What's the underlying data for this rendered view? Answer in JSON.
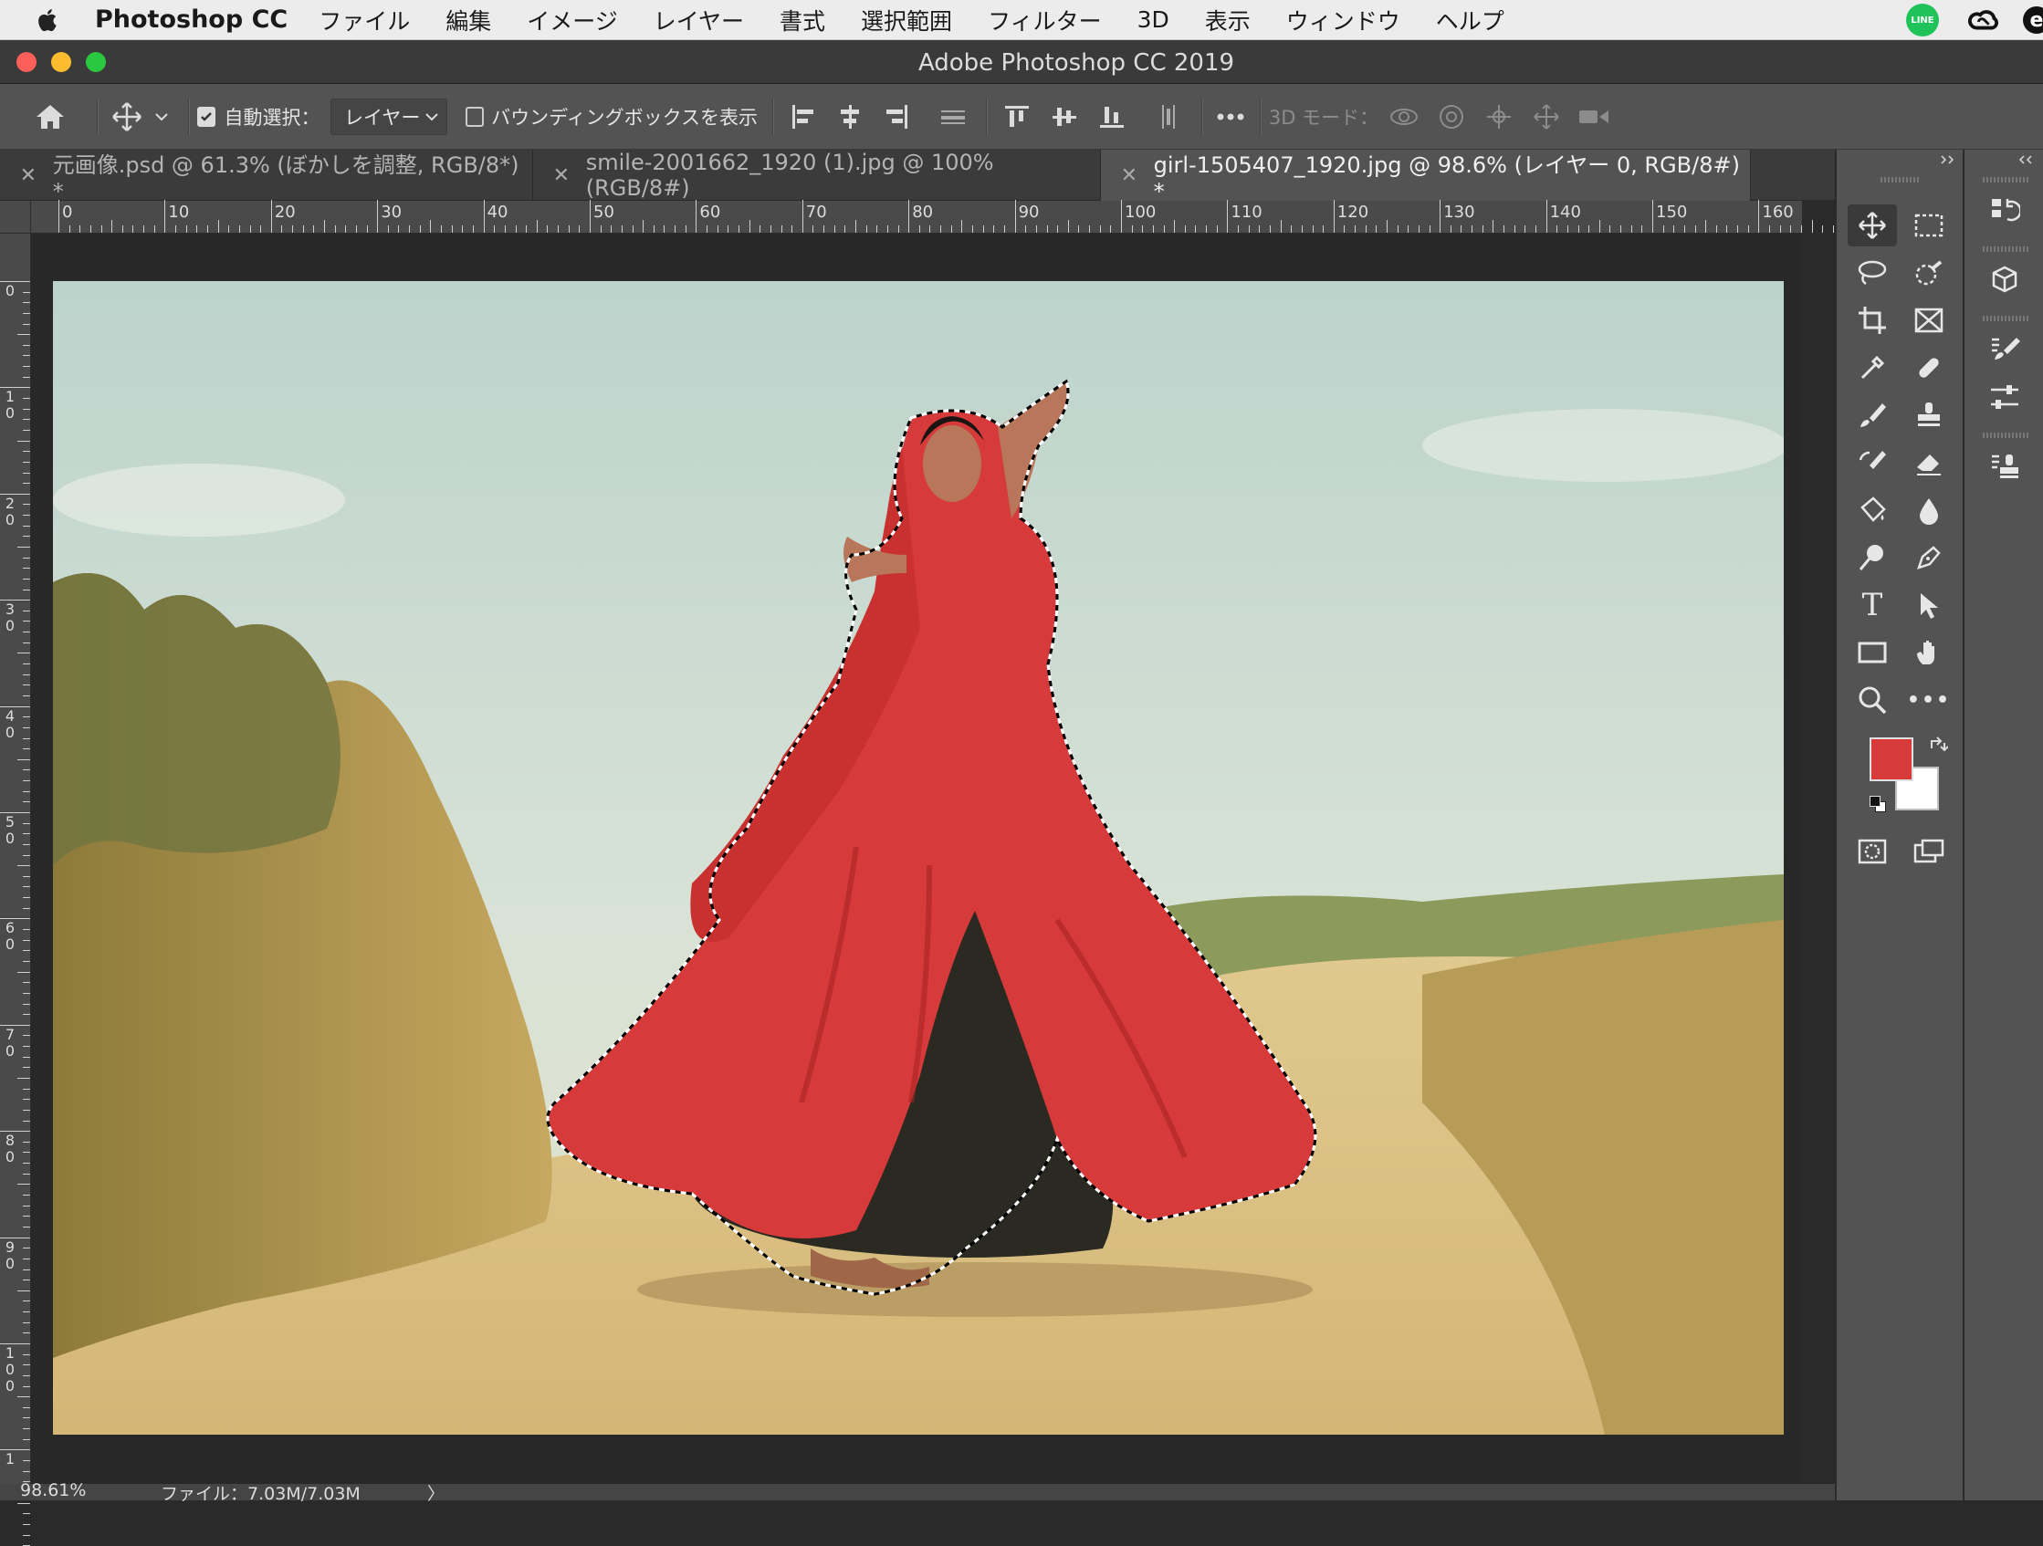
{
  "menubar": {
    "app_name": "Photoshop CC",
    "items": [
      "ファイル",
      "編集",
      "イメージ",
      "レイヤー",
      "書式",
      "選択範囲",
      "フィルター",
      "3D",
      "表示",
      "ウィンドウ",
      "ヘルプ"
    ],
    "line_icon_text": "LINE",
    "e_icon_text": "e"
  },
  "window": {
    "title": "Adobe Photoshop CC 2019"
  },
  "options_bar": {
    "auto_select_label": "自動選択：",
    "auto_select_value": "レイヤー",
    "bounding_box_label": "バウンディングボックスを表示",
    "mode_3d_label": "3D モード："
  },
  "tabs": [
    {
      "label": "元画像.psd @ 61.3% (ぼかしを調整, RGB/8*) *",
      "active": false
    },
    {
      "label": "smile-2001662_1920 (1).jpg @ 100% (RGB/8#)",
      "active": false
    },
    {
      "label": "girl-1505407_1920.jpg @ 98.6% (レイヤー 0, RGB/8#) *",
      "active": true
    }
  ],
  "rulers": {
    "horizontal": [
      "0",
      "10",
      "20",
      "30",
      "40",
      "50",
      "60",
      "70",
      "80",
      "90",
      "100",
      "110",
      "120",
      "130",
      "140",
      "150",
      "160"
    ],
    "vertical": [
      "0",
      "1 0",
      "2 0",
      "3 0",
      "4 0",
      "5 0",
      "6 0",
      "7 0",
      "8 0",
      "9 0",
      "1 0 0",
      "1"
    ]
  },
  "status": {
    "zoom": "98.61%",
    "file_info": "ファイル：7.03M/7.03M",
    "arrow": "〉"
  },
  "colors": {
    "foreground": "#d63a3a",
    "background": "#ffffff",
    "ui_dark": "#535353"
  },
  "tools_text": {
    "type_tool": "T",
    "more": "•••"
  }
}
